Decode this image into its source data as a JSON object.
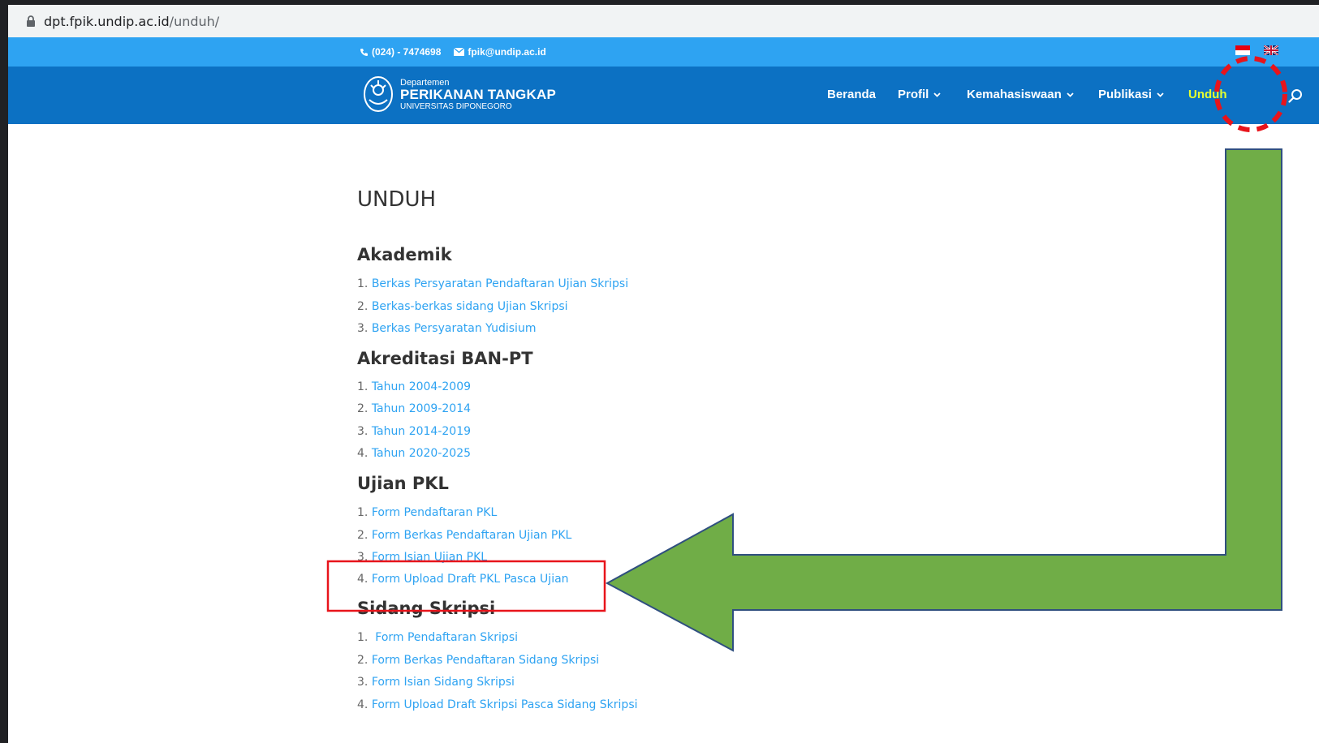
{
  "browser": {
    "url_host": "dpt.fpik.undip.ac.id",
    "url_path": "/unduh/"
  },
  "topbar": {
    "phone": "(024) - 7474698",
    "email": "fpik@undip.ac.id"
  },
  "logo": {
    "line1": "Departemen",
    "line2": "PERIKANAN TANGKAP",
    "line3": "UNIVERSITAS DIPONEGORO"
  },
  "nav": {
    "beranda": "Beranda",
    "profil": "Profil",
    "kemahasiswaan": "Kemahasiswaan",
    "publikasi": "Publikasi",
    "unduh": "Unduh"
  },
  "page": {
    "title": "UNDUH"
  },
  "sections": [
    {
      "title": "Akademik",
      "items": [
        {
          "num": "1.",
          "label": "Berkas Persyaratan Pendaftaran Ujian Skripsi"
        },
        {
          "num": "2.",
          "label": "Berkas-berkas sidang Ujian Skripsi"
        },
        {
          "num": "3.",
          "label": "Berkas Persyaratan Yudisium"
        }
      ]
    },
    {
      "title": "Akreditasi BAN-PT",
      "items": [
        {
          "num": "1.",
          "label": "Tahun 2004-2009"
        },
        {
          "num": "2.",
          "label": "Tahun 2009-2014"
        },
        {
          "num": "3.",
          "label": "Tahun 2014-2019"
        },
        {
          "num": "4.",
          "label": "Tahun 2020-2025"
        }
      ]
    },
    {
      "title": "Ujian PKL",
      "items": [
        {
          "num": "1.",
          "label": "Form Pendaftaran PKL"
        },
        {
          "num": "2.",
          "label": "Form Berkas Pendaftaran Ujian PKL"
        },
        {
          "num": "3.",
          "label": "Form Isian Ujian PKL"
        },
        {
          "num": "4.",
          "label": "Form Upload Draft PKL Pasca Ujian"
        }
      ]
    },
    {
      "title": "Sidang Skripsi",
      "items": [
        {
          "num": "1.",
          "label": "Form Pendaftaran Skripsi"
        },
        {
          "num": "2.",
          "label": "Form Berkas Pendaftaran Sidang Skripsi"
        },
        {
          "num": "3.",
          "label": "Form Isian Sidang Skripsi"
        },
        {
          "num": "4.",
          "label": "Form Upload Draft Skripsi Pasca Sidang Skripsi"
        }
      ]
    }
  ],
  "colors": {
    "topbar": "#2ea3f2",
    "header": "#0c71c3",
    "link": "#2ea3f2",
    "active_nav": "#e5ff2f",
    "annotation_red": "#e8141b",
    "annotation_arrow": "#70ad47"
  },
  "icons": [
    "lock-icon",
    "phone-icon",
    "email-icon",
    "flag-id-icon",
    "flag-uk-icon",
    "search-icon",
    "chevron-down-icon"
  ]
}
